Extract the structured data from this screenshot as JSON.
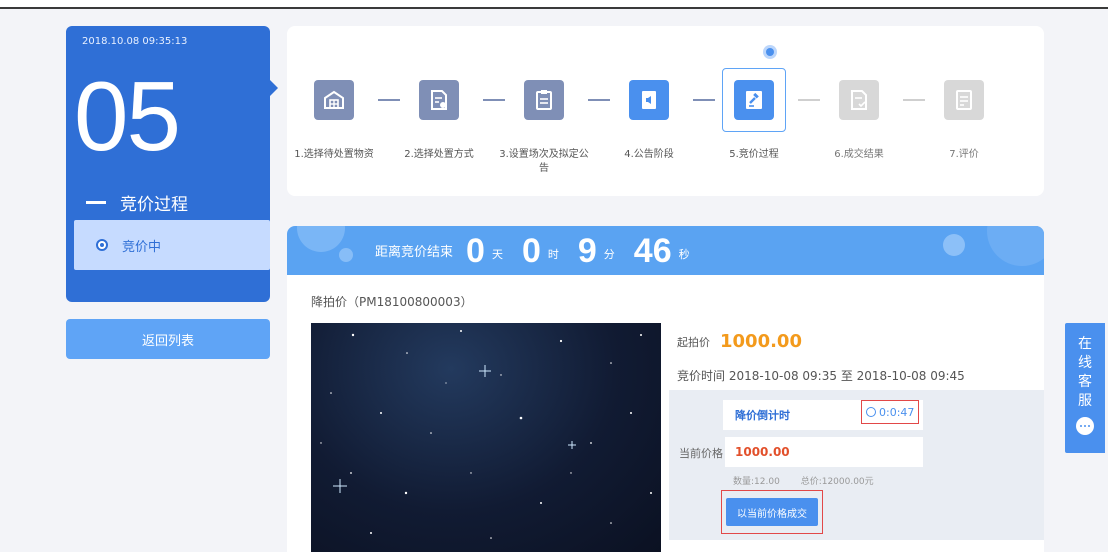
{
  "datetime": "2018.10.08 09:35:13",
  "stage_number": "05",
  "stage_title": "竞价过程",
  "stage_status": "竞价中",
  "back_button": "返回列表",
  "steps": [
    {
      "label": "1.选择待处置物资",
      "state": "done",
      "icon": "warehouse-icon"
    },
    {
      "label": "2.选择处置方式",
      "state": "done",
      "icon": "document-setting-icon"
    },
    {
      "label": "3.设置场次及拟定公告",
      "state": "done",
      "icon": "clipboard-icon"
    },
    {
      "label": "4.公告阶段",
      "state": "done",
      "icon": "announcement-icon"
    },
    {
      "label": "5.竞价过程",
      "state": "current",
      "icon": "gavel-icon"
    },
    {
      "label": "6.成交结果",
      "state": "pending",
      "icon": "document-check-icon"
    },
    {
      "label": "7.评价",
      "state": "pending",
      "icon": "evaluation-icon"
    }
  ],
  "countdown": {
    "lead": "距离竞价结束",
    "days": "0",
    "days_unit": "天",
    "hours": "0",
    "hours_unit": "时",
    "minutes": "9",
    "minutes_unit": "分",
    "seconds": "46",
    "seconds_unit": "秒"
  },
  "lot": {
    "id": "降拍价（PM18100800003）",
    "start_price_label": "起拍价",
    "start_price": "1000.00",
    "time_label": "竞价时间",
    "time_start": "2018-10-08 09:35",
    "time_sep": "至",
    "time_end": "2018-10-08 09:45",
    "drop_countdown_label": "降价倒计时",
    "drop_countdown_value": "0:0:47",
    "current_price_label": "当前价格",
    "current_price": "1000.00",
    "quantity": "数量:12.00",
    "total": "总价:12000.00元",
    "deal_button": "以当前价格成交"
  },
  "service": [
    "在",
    "线",
    "客",
    "服"
  ],
  "colors": {
    "primary": "#2f6fd6",
    "accent": "#4a90ee",
    "price_orange": "#f39a1c",
    "price_red": "#e2502b",
    "highlight_border": "#e24848"
  }
}
